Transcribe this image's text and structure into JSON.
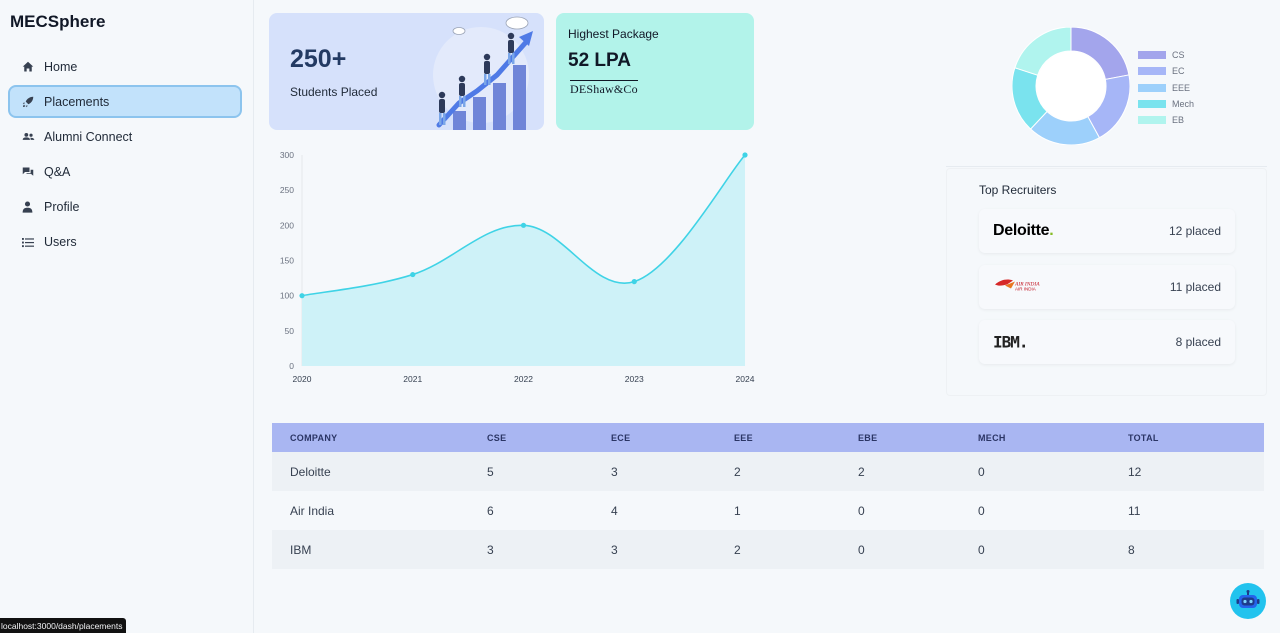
{
  "sidebar": {
    "brand": "MECSphere",
    "items": [
      {
        "label": "Home",
        "icon": "home-icon",
        "active": false
      },
      {
        "label": "Placements",
        "icon": "rocket-icon",
        "active": true
      },
      {
        "label": "Alumni Connect",
        "icon": "users-icon",
        "active": false
      },
      {
        "label": "Q&A",
        "icon": "chat-icon",
        "active": false
      },
      {
        "label": "Profile",
        "icon": "user-icon",
        "active": false
      },
      {
        "label": "Users",
        "icon": "list-icon",
        "active": false
      }
    ]
  },
  "stats": {
    "placed_value": "250+",
    "placed_label": "Students Placed",
    "package_title": "Highest Package",
    "package_value": "52 LPA",
    "package_company": "DEShaw&Co"
  },
  "chart_data": [
    {
      "type": "area",
      "x": [
        "2020",
        "2021",
        "2022",
        "2023",
        "2024"
      ],
      "values": [
        100,
        130,
        200,
        120,
        300
      ],
      "ylim": [
        0,
        300
      ],
      "yticks": [
        0,
        50,
        100,
        150,
        200,
        250,
        300
      ],
      "grid": false,
      "color": "#3fd3e6",
      "fill": "#cef2f8"
    },
    {
      "type": "pie",
      "categories": [
        "CS",
        "EC",
        "EEE",
        "Mech",
        "EB"
      ],
      "values": [
        22,
        20,
        20,
        18,
        20
      ],
      "colors": [
        "#a3a5ec",
        "#a6b6f7",
        "#9dd0fb",
        "#7ae3ee",
        "#b0f4ee"
      ],
      "legend": "right"
    }
  ],
  "recruiters": {
    "title": "Top Recruiters",
    "items": [
      {
        "name": "Deloitte",
        "count": "12 placed"
      },
      {
        "name": "Air India",
        "count": "11 placed"
      },
      {
        "name": "IBM",
        "count": "8 placed"
      }
    ]
  },
  "table": {
    "headers": [
      "COMPANY",
      "CSE",
      "ECE",
      "EEE",
      "EBE",
      "MECH",
      "TOTAL"
    ],
    "rows": [
      [
        "Deloitte",
        "5",
        "3",
        "2",
        "2",
        "0",
        "12"
      ],
      [
        "Air India",
        "6",
        "4",
        "1",
        "0",
        "0",
        "11"
      ],
      [
        "IBM",
        "3",
        "3",
        "2",
        "0",
        "0",
        "8"
      ]
    ]
  },
  "status_url": "localhost:3000/dash/placements"
}
